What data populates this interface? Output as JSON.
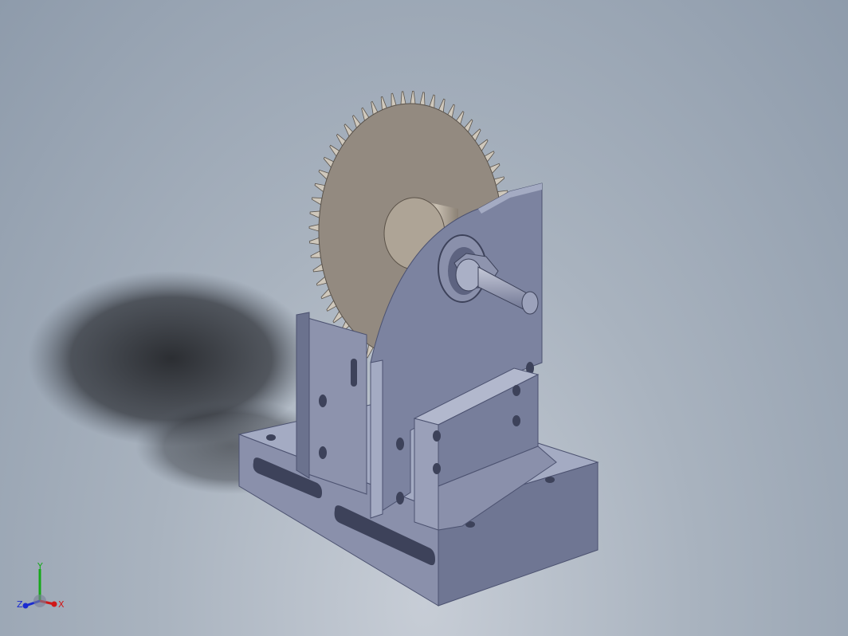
{
  "scene": {
    "colors": {
      "bg_top": "#8e9bab",
      "bg_bottom": "#c7cdd6",
      "steel_top": "#a4abc3",
      "steel_front": "#7d84a0",
      "steel_side": "#6b728e",
      "gear_face": "#9a9187",
      "gear_teeth": "#cfc8bc",
      "shadow": "#2a2c30"
    },
    "components": [
      "base-plate",
      "support-bracket",
      "spur-gear",
      "hub",
      "shaft",
      "nut",
      "clamp-block"
    ]
  },
  "triad": {
    "x_label": "X",
    "y_label": "Y",
    "z_label": "Z",
    "x_color": "#d01818",
    "y_color": "#16a81a",
    "z_color": "#1a2bd0"
  }
}
